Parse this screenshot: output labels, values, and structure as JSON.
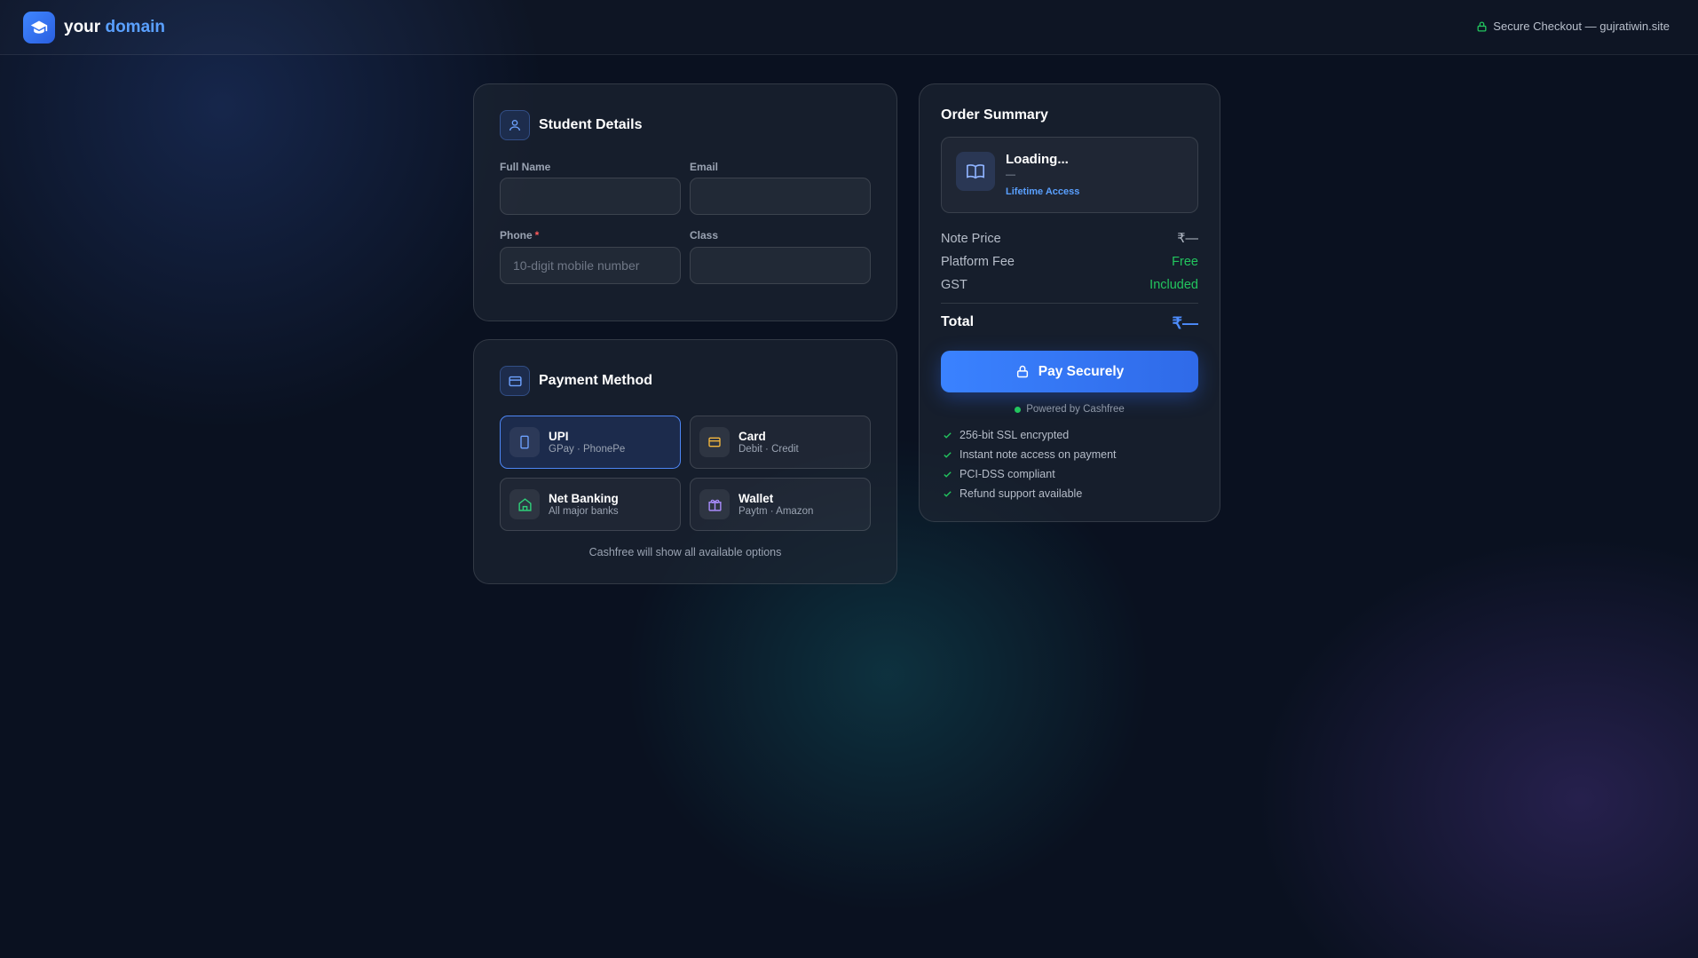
{
  "header": {
    "brand_prefix": "your",
    "brand_accent": "domain",
    "secure_text": "Secure Checkout — gujratiwin.site"
  },
  "student": {
    "title": "Student Details",
    "full_name_label": "Full Name",
    "email_label": "Email",
    "phone_label": "Phone",
    "phone_required_mark": "*",
    "phone_placeholder": "10-digit mobile number",
    "class_label": "Class"
  },
  "payment": {
    "title": "Payment Method",
    "methods": [
      {
        "title": "UPI",
        "sub": "GPay · PhonePe",
        "icon": "phone-icon",
        "selected": true
      },
      {
        "title": "Card",
        "sub": "Debit · Credit",
        "icon": "card-icon",
        "selected": false
      },
      {
        "title": "Net Banking",
        "sub": "All major banks",
        "icon": "bank-icon",
        "selected": false
      },
      {
        "title": "Wallet",
        "sub": "Paytm · Amazon",
        "icon": "wallet-icon",
        "selected": false
      }
    ],
    "note": "Cashfree will show all available options"
  },
  "summary": {
    "title": "Order Summary",
    "product_name": "Loading...",
    "product_sub": "—",
    "product_access": "Lifetime Access",
    "note_price_label": "Note Price",
    "note_price_value": "₹—",
    "platform_fee_label": "Platform Fee",
    "platform_fee_value": "Free",
    "gst_label": "GST",
    "gst_value": "Included",
    "total_label": "Total",
    "total_value": "₹—",
    "pay_label": "Pay Securely",
    "powered_by": "Powered by Cashfree",
    "features": [
      "256-bit SSL encrypted",
      "Instant note access on payment",
      "PCI-DSS compliant",
      "Refund support available"
    ]
  },
  "colors": {
    "accent": "#3a82ff",
    "success": "#22c55e",
    "card_icon": "#f5b83d",
    "bank_icon": "#2fd07a",
    "wallet_icon": "#a78bfa"
  }
}
